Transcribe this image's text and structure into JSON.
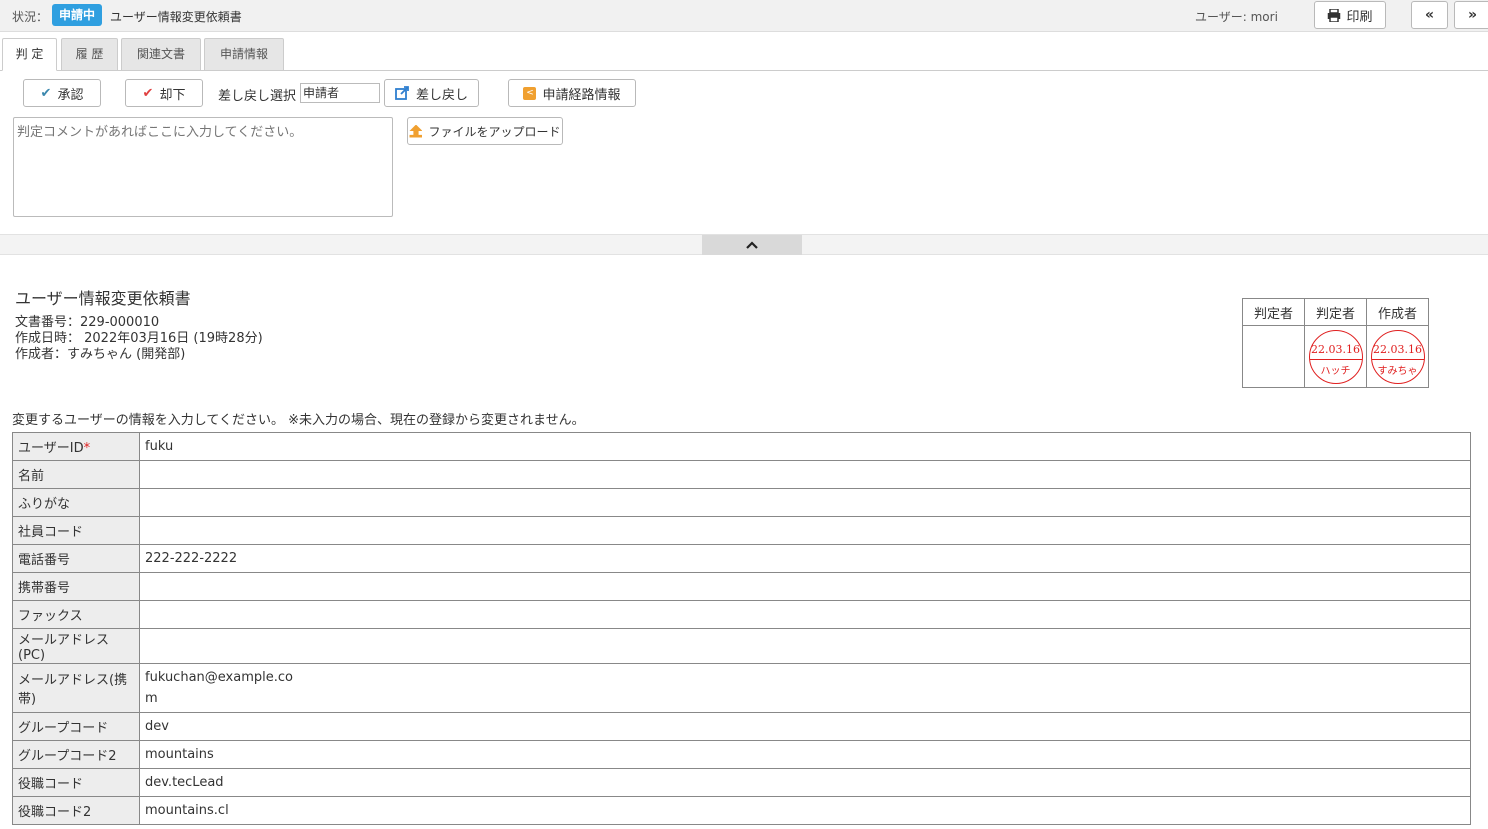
{
  "header": {
    "status_label": "状況：",
    "status_badge": "申請中",
    "doc_title": "ユーザー情報変更依頼書",
    "user_label": "ユーザー: mori",
    "print_label": "印刷",
    "prev_label": "«",
    "next_label": "»"
  },
  "tabs": [
    {
      "label": "判 定"
    },
    {
      "label": "履 歴"
    },
    {
      "label": "関連文書"
    },
    {
      "label": "申請情報"
    }
  ],
  "actions": {
    "approve_label": "承認",
    "reject_label": "却下",
    "sendback_select_label": "差し戻し選択",
    "sendback_select_value": "申請者",
    "sendback_label": "差し戻し",
    "route_info_label": "申請経路情報",
    "upload_label": "ファイルをアップロード",
    "comment_placeholder": "判定コメントがあればここに入力してください。"
  },
  "document": {
    "heading": "ユーザー情報変更依頼書",
    "doc_number": "文書番号：229-000010",
    "created_at": "作成日時： 2022年03月16日 (19時28分)",
    "author": "作成者：すみちゃん (開発部)",
    "instruction": "変更するユーザーの情報を入力してください。 ※未入力の場合、現在の登録から変更されません。"
  },
  "stamps": {
    "headers": [
      "判定者",
      "判定者",
      "作成者"
    ],
    "cells": [
      {
        "date": "",
        "name": ""
      },
      {
        "date": "22.03.16",
        "name": "ハッチ"
      },
      {
        "date": "22.03.16",
        "name": "すみちゃ"
      }
    ]
  },
  "fields": [
    {
      "label": "ユーザーID",
      "required_mark": "*",
      "value": "fuku"
    },
    {
      "label": "名前",
      "value": ""
    },
    {
      "label": "ふりがな",
      "value": ""
    },
    {
      "label": "社員コード",
      "value": ""
    },
    {
      "label": "電話番号",
      "value": "222-222-2222"
    },
    {
      "label": "携帯番号",
      "value": ""
    },
    {
      "label": "ファックス",
      "value": ""
    },
    {
      "label": "メールアドレス(PC)",
      "value": ""
    },
    {
      "label": "メールアドレス(携帯)",
      "value": "fukuchan@example.co",
      "value_line2": "m"
    },
    {
      "label": "グループコード",
      "value": "dev"
    },
    {
      "label": "グループコード2",
      "value": "mountains"
    },
    {
      "label": "役職コード",
      "value": "dev.tecLead"
    },
    {
      "label": "役職コード2",
      "value": "mountains.cl"
    }
  ],
  "colors": {
    "status_badge": "#2f9fe0",
    "stamp_red": "#e02020",
    "label_bg": "#ededed"
  }
}
